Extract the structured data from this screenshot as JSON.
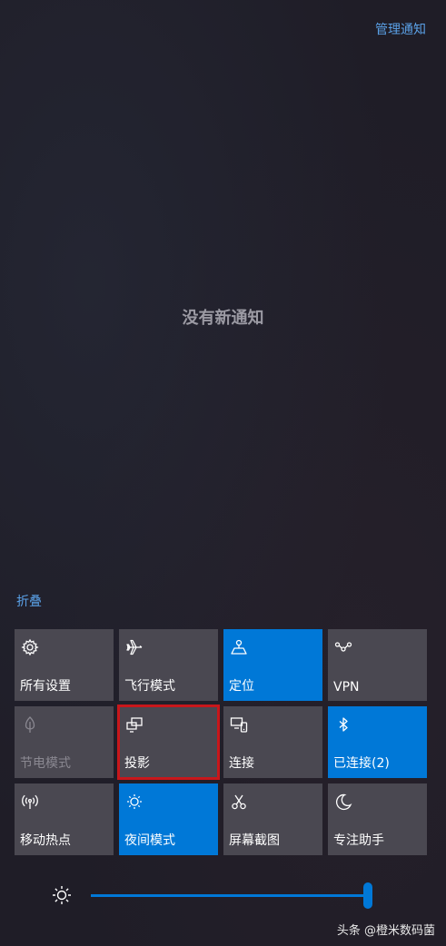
{
  "header": {
    "manage_notifications": "管理通知"
  },
  "main": {
    "empty_message": "没有新通知"
  },
  "quick_actions": {
    "collapse_label": "折叠",
    "tiles": [
      {
        "label": "所有设置",
        "icon": "gear-icon",
        "active": false
      },
      {
        "label": "飞行模式",
        "icon": "airplane-icon",
        "active": false
      },
      {
        "label": "定位",
        "icon": "location-icon",
        "active": true
      },
      {
        "label": "VPN",
        "icon": "vpn-icon",
        "active": false
      },
      {
        "label": "节电模式",
        "icon": "battery-saver-icon",
        "active": false,
        "disabled": true
      },
      {
        "label": "投影",
        "icon": "project-icon",
        "active": false,
        "highlighted": true
      },
      {
        "label": "连接",
        "icon": "connect-icon",
        "active": false
      },
      {
        "label": "已连接(2)",
        "icon": "bluetooth-icon",
        "active": true
      },
      {
        "label": "移动热点",
        "icon": "hotspot-icon",
        "active": false
      },
      {
        "label": "夜间模式",
        "icon": "night-light-icon",
        "active": true
      },
      {
        "label": "屏幕截图",
        "icon": "screen-snip-icon",
        "active": false
      },
      {
        "label": "专注助手",
        "icon": "focus-assist-icon",
        "active": false
      }
    ]
  },
  "brightness": {
    "level": 1.0
  },
  "watermark": {
    "text": "头条 @橙米数码菌"
  },
  "colors": {
    "accent": "#0078d7",
    "tile_bg": "#4a4851",
    "highlight_box": "#c8171b",
    "link": "#5aa0e6"
  }
}
